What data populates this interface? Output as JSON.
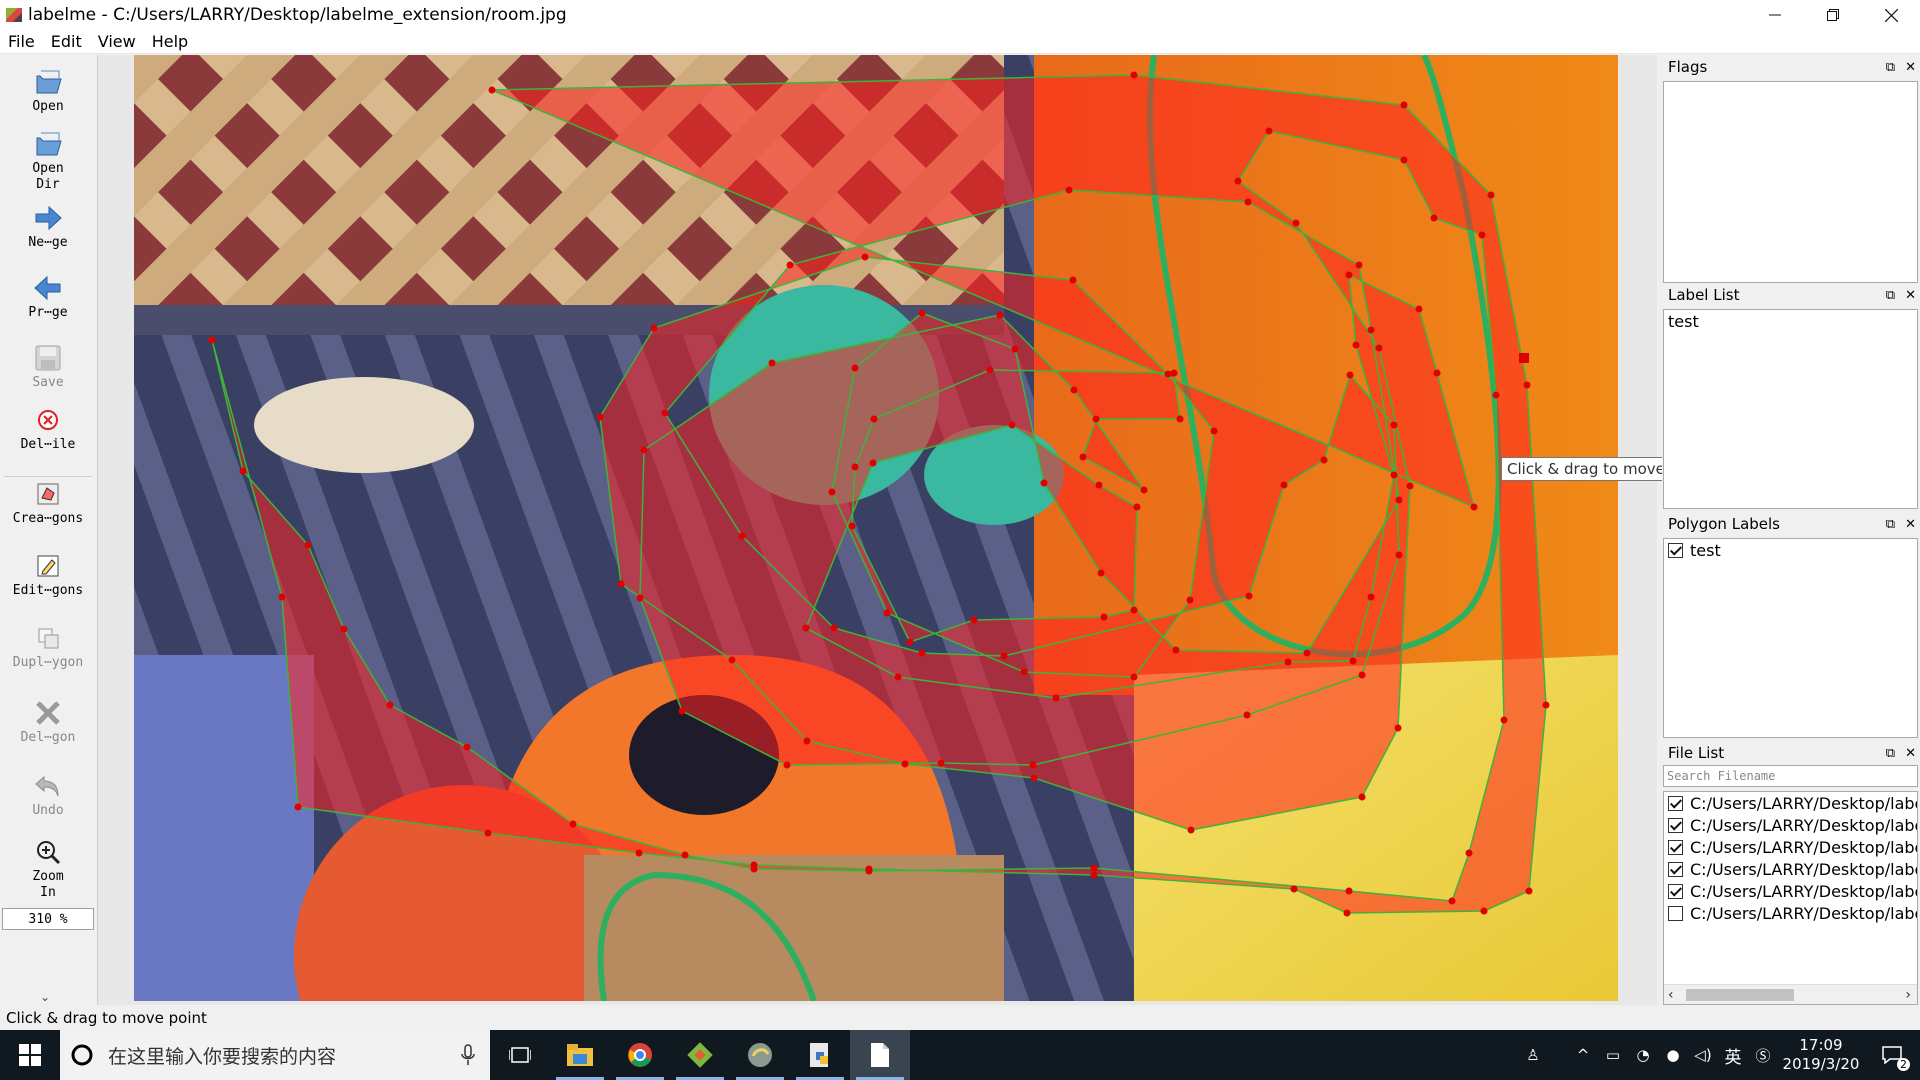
{
  "window": {
    "title": "labelme - C:/Users/LARRY/Desktop/labelme_extension/room.jpg",
    "controls": [
      "minimize-icon",
      "restore-icon",
      "close-icon"
    ]
  },
  "menu": [
    "File",
    "Edit",
    "View",
    "Help"
  ],
  "toolbar": {
    "tools": [
      {
        "label": "Open",
        "icon": "open-file-icon",
        "enabled": true
      },
      {
        "label": "Open\nDir",
        "icon": "open-dir-icon",
        "enabled": true
      },
      {
        "label": "Ne⋯ge",
        "icon": "next-arrow-icon",
        "enabled": true
      },
      {
        "label": "Pr⋯ge",
        "icon": "prev-arrow-icon",
        "enabled": true
      },
      {
        "label": "Save",
        "icon": "save-icon",
        "enabled": false
      },
      {
        "label": "Del⋯ile",
        "icon": "delete-file-icon",
        "enabled": true
      },
      {
        "label": "Crea⋯gons",
        "icon": "create-polygon-icon",
        "enabled": true
      },
      {
        "label": "Edit⋯gons",
        "icon": "edit-polygon-icon",
        "enabled": true
      },
      {
        "label": "Dupl⋯ygon",
        "icon": "duplicate-icon",
        "enabled": false
      },
      {
        "label": "Del⋯gon",
        "icon": "delete-polygon-icon",
        "enabled": false
      },
      {
        "label": "Undo",
        "icon": "undo-icon",
        "enabled": false
      },
      {
        "label": "Zoom\nIn",
        "icon": "zoom-in-icon",
        "enabled": true
      }
    ],
    "zoom_value": "310 %"
  },
  "canvas": {
    "image_file": "room.jpg",
    "tooltip": "Click & drag to move point",
    "polygon_color": "#ff0000",
    "edge_color": "#3cb43c",
    "vertex_color": "#e00000"
  },
  "docks": {
    "flags": {
      "title": "Flags",
      "items": []
    },
    "label_list": {
      "title": "Label List",
      "items": [
        "test"
      ]
    },
    "polygon_labels": {
      "title": "Polygon Labels",
      "items": [
        {
          "label": "test",
          "checked": true
        }
      ]
    },
    "file_list": {
      "title": "File List",
      "search_placeholder": "Search Filename",
      "items": [
        {
          "path": "C:/Users/LARRY/Desktop/labelm",
          "checked": true
        },
        {
          "path": "C:/Users/LARRY/Desktop/labelm",
          "checked": true
        },
        {
          "path": "C:/Users/LARRY/Desktop/labelm",
          "checked": true
        },
        {
          "path": "C:/Users/LARRY/Desktop/labelm",
          "checked": true
        },
        {
          "path": "C:/Users/LARRY/Desktop/labelm",
          "checked": true
        },
        {
          "path": "C:/Users/LARRY/Desktop/labelm",
          "checked": false
        }
      ]
    }
  },
  "status": "Click & drag to move point",
  "taskbar": {
    "search_placeholder": "在这里输入你要搜索的内容",
    "apps": [
      "task-view-icon",
      "file-explorer-icon",
      "chrome-icon",
      "git-icon",
      "python-icon",
      "python-file-icon",
      "document-icon"
    ],
    "time": "17:09",
    "date": "2019/3/20",
    "ime": "英",
    "notification_count": "2"
  }
}
